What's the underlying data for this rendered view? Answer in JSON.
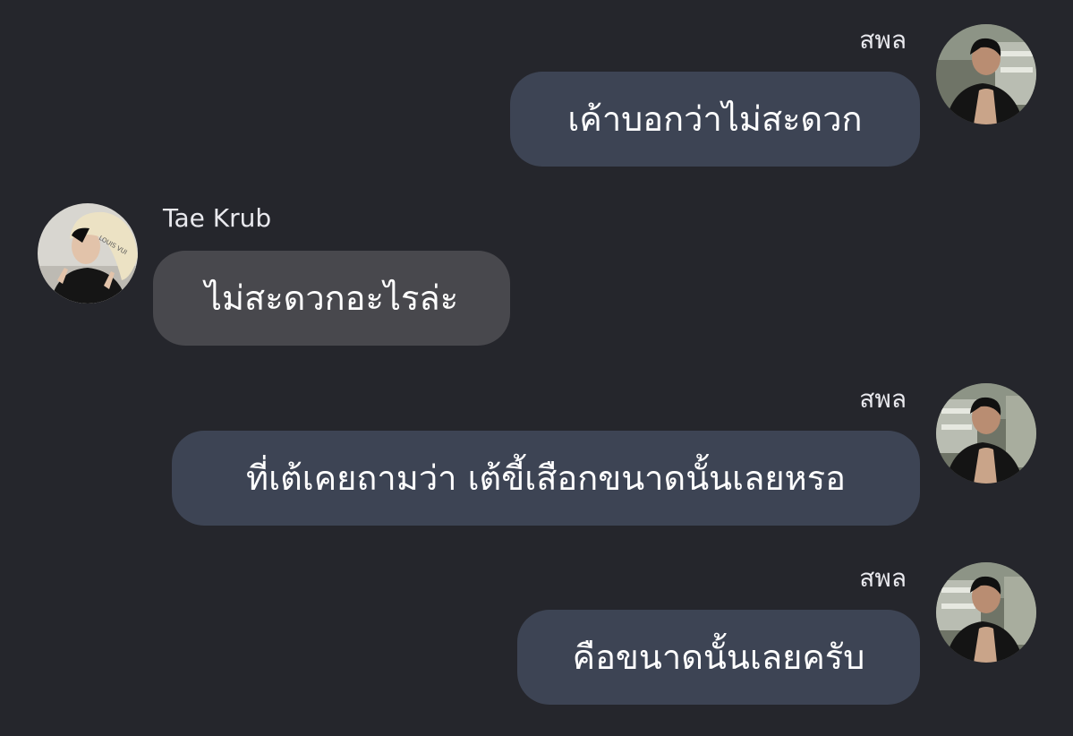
{
  "colors": {
    "background": "#25262c",
    "outgoing_bubble": "#3d4454",
    "incoming_bubble": "#48484d",
    "text": "#ffffff"
  },
  "messages": [
    {
      "sender": "สพล",
      "text": "เค้าบอกว่าไม่สะดวก",
      "direction": "outgoing"
    },
    {
      "sender": "Tae Krub",
      "text": "ไม่สะดวกอะไรล่ะ",
      "direction": "incoming"
    },
    {
      "sender": "สพล",
      "text": "ที่เต้เคยถามว่า เต้ขี้เสือกขนาดนั้นเลยหรอ",
      "direction": "outgoing"
    },
    {
      "sender": "สพล",
      "text": "คือขนาดนั้นเลยครับ",
      "direction": "outgoing"
    }
  ]
}
